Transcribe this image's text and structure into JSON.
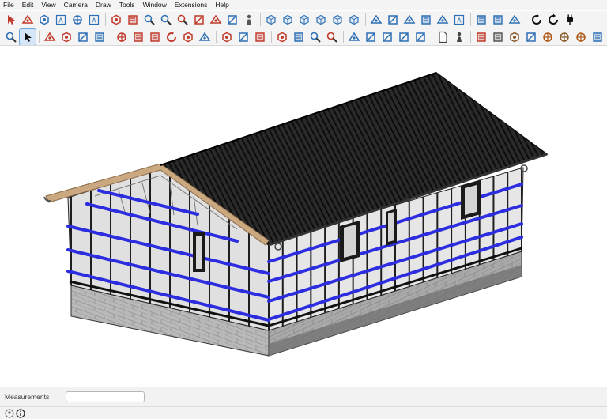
{
  "menu": [
    "File",
    "Edit",
    "View",
    "Camera",
    "Draw",
    "Tools",
    "Window",
    "Extensions",
    "Help"
  ],
  "toolbar1": [
    {
      "icon": "select-icon",
      "color": "#c0392b"
    },
    {
      "icon": "eraser-icon",
      "color": "#c0392b"
    },
    {
      "icon": "arc-icon",
      "color": "#2c6fb5"
    },
    {
      "icon": "text-icon",
      "color": "#2c6fb5"
    },
    {
      "icon": "axes-icon",
      "color": "#2c6fb5"
    },
    {
      "icon": "3d-text-icon",
      "color": "#2c6fb5"
    },
    {
      "icon": "section-plane-icon",
      "color": "#c0392b"
    },
    {
      "icon": "orbit-icon",
      "color": "#c0392b"
    },
    {
      "icon": "zoom-icon",
      "color": "#2c6fb5"
    },
    {
      "icon": "zoom-window-icon",
      "color": "#2c6fb5"
    },
    {
      "icon": "zoom-extents-icon",
      "color": "#c0392b"
    },
    {
      "icon": "previous-view-icon",
      "color": "#c0392b"
    },
    {
      "icon": "position-camera-icon",
      "color": "#c0392b"
    },
    {
      "icon": "look-around-icon",
      "color": "#2c6fb5"
    },
    {
      "icon": "walk-icon",
      "color": "#555555"
    },
    {
      "icon": "iso-view-icon",
      "color": "#2c6fb5"
    },
    {
      "icon": "top-view-icon",
      "color": "#2c6fb5"
    },
    {
      "icon": "front-view-icon",
      "color": "#2c6fb5"
    },
    {
      "icon": "right-view-icon",
      "color": "#2c6fb5"
    },
    {
      "icon": "back-view-icon",
      "color": "#2c6fb5"
    },
    {
      "icon": "left-view-icon",
      "color": "#2c6fb5"
    },
    {
      "icon": "xray-icon",
      "color": "#2c6fb5"
    },
    {
      "icon": "back-edges-icon",
      "color": "#2c6fb5"
    },
    {
      "icon": "wireframe-icon",
      "color": "#2c6fb5"
    },
    {
      "icon": "hidden-line-icon",
      "color": "#2c6fb5"
    },
    {
      "icon": "shaded-icon",
      "color": "#2c6fb5"
    },
    {
      "icon": "shaded-textures-icon",
      "color": "#2c6fb5"
    },
    {
      "icon": "monochrome-icon",
      "color": "#2c6fb5"
    },
    {
      "icon": "component-icon",
      "color": "#2c6fb5"
    },
    {
      "icon": "group-icon",
      "color": "#2c6fb5"
    },
    {
      "icon": "refresh-icon",
      "color": "#111111"
    },
    {
      "icon": "sync-icon",
      "color": "#111111"
    },
    {
      "icon": "plugin-icon",
      "color": "#111111"
    }
  ],
  "toolbar2": [
    {
      "icon": "search-icon",
      "color": "#2c6fb5"
    },
    {
      "icon": "select-arrow-icon",
      "color": "#111111",
      "active": true
    },
    {
      "icon": "eraser-icon",
      "color": "#c0392b"
    },
    {
      "icon": "pencil-icon",
      "color": "#c0392b"
    },
    {
      "icon": "arc-tool-icon",
      "color": "#2c6fb5"
    },
    {
      "icon": "rectangle-icon",
      "color": "#2c6fb5"
    },
    {
      "icon": "push-pull-icon",
      "color": "#c0392b"
    },
    {
      "icon": "follow-me-icon",
      "color": "#c0392b"
    },
    {
      "icon": "move-icon",
      "color": "#c0392b"
    },
    {
      "icon": "rotate-icon",
      "color": "#c0392b"
    },
    {
      "icon": "scale-icon",
      "color": "#c0392b"
    },
    {
      "icon": "offset-icon",
      "color": "#2c6fb5"
    },
    {
      "icon": "tape-measure-icon",
      "color": "#c0392b"
    },
    {
      "icon": "dimension-icon",
      "color": "#2c6fb5"
    },
    {
      "icon": "protractor-icon",
      "color": "#c0392b"
    },
    {
      "icon": "orbit-tool-icon",
      "color": "#c0392b"
    },
    {
      "icon": "pan-icon",
      "color": "#2c6fb5"
    },
    {
      "icon": "zoom-tool-icon",
      "color": "#2c6fb5"
    },
    {
      "icon": "zoom-extents-tool-icon",
      "color": "#c0392b"
    },
    {
      "icon": "materials-icon",
      "color": "#2c6fb5"
    },
    {
      "icon": "layers-icon",
      "color": "#2c6fb5"
    },
    {
      "icon": "tags-icon",
      "color": "#2c6fb5"
    },
    {
      "icon": "styles-icon",
      "color": "#2c6fb5"
    },
    {
      "icon": "scenes-icon",
      "color": "#2c6fb5"
    },
    {
      "icon": "document-icon",
      "color": "#444444"
    },
    {
      "icon": "user-icon",
      "color": "#444444"
    },
    {
      "icon": "warehouse-icon",
      "color": "#c0392b"
    },
    {
      "icon": "ruler-icon",
      "color": "#555555"
    },
    {
      "icon": "solid-tools-icon",
      "color": "#8a5a2a"
    },
    {
      "icon": "sandbox-icon",
      "color": "#2c6fb5"
    },
    {
      "icon": "brick-icon",
      "color": "#b05a1a"
    },
    {
      "icon": "fence-icon",
      "color": "#8a5a2a"
    },
    {
      "icon": "frame-icon",
      "color": "#b05a1a"
    },
    {
      "icon": "box-icon",
      "color": "#2c6fb5"
    },
    {
      "icon": "cube-icon",
      "color": "#b05a1a"
    }
  ],
  "status": {
    "measurements_label": "Measurements",
    "measurements_value": ""
  }
}
